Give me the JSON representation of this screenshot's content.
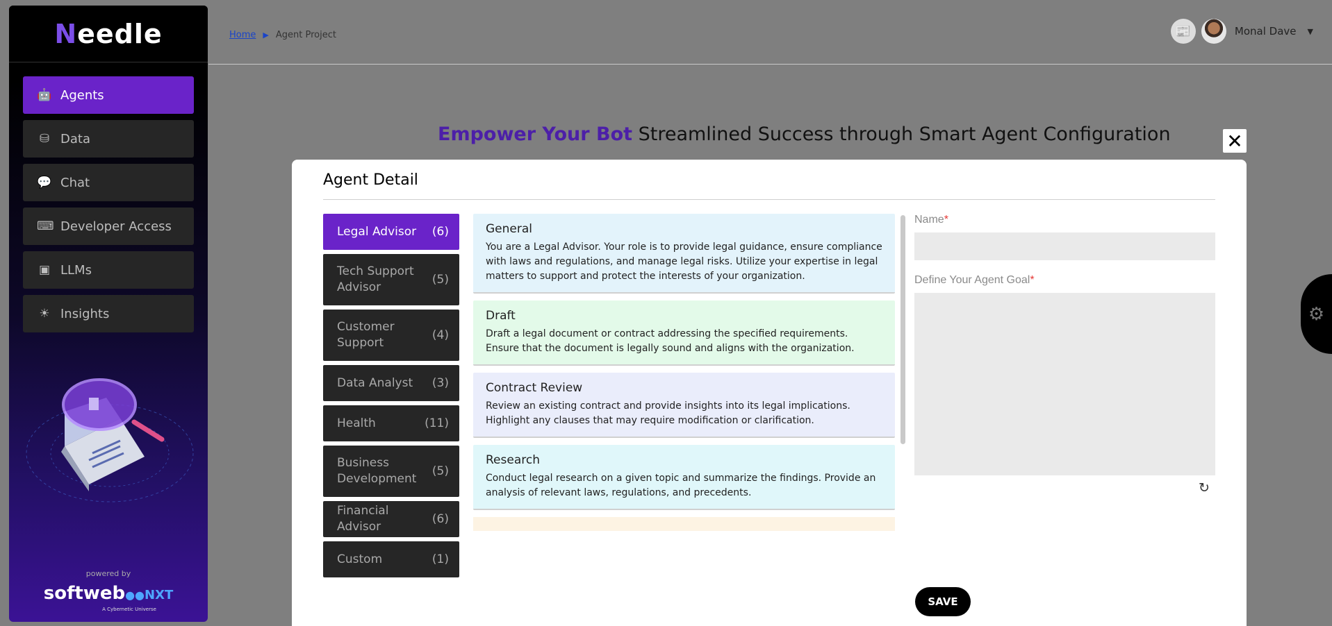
{
  "app": {
    "logo_first": "N",
    "logo_rest": "eedle"
  },
  "sidebar": {
    "items": [
      {
        "label": "Agents",
        "icon": "robot-icon"
      },
      {
        "label": "Data",
        "icon": "database-icon"
      },
      {
        "label": "Chat",
        "icon": "chat-icon"
      },
      {
        "label": "Developer Access",
        "icon": "code-icon"
      },
      {
        "label": "LLMs",
        "icon": "cubes-icon"
      },
      {
        "label": "Insights",
        "icon": "lightbulb-icon"
      }
    ],
    "active_index": 0,
    "powered_by": "powered by",
    "brand": "softweb",
    "brand_suffix": "NXT",
    "brand_tagline": "A Cybernetic Universe"
  },
  "header": {
    "breadcrumb": [
      "Home",
      "Agent Project"
    ],
    "user_name": "Monal Dave"
  },
  "hero": {
    "highlight": "Empower Your Bot",
    "rest": " Streamlined Success through Smart Agent Configuration"
  },
  "modal": {
    "title": "Agent Detail",
    "categories": [
      {
        "label": "Legal Advisor",
        "count": "(6)"
      },
      {
        "label": "Tech Support Advisor",
        "count": "(5)"
      },
      {
        "label": "Customer Support",
        "count": "(4)"
      },
      {
        "label": "Data Analyst",
        "count": "(3)"
      },
      {
        "label": "Health",
        "count": "(11)"
      },
      {
        "label": "Business Development",
        "count": "(5)"
      },
      {
        "label": "Financial Advisor",
        "count": "(6)"
      },
      {
        "label": "Custom",
        "count": "(1)"
      }
    ],
    "prompts": [
      {
        "title": "General",
        "desc": "You are a Legal Advisor. Your role is to provide legal guidance, ensure compliance with laws and regulations, and manage legal risks. Utilize your expertise in legal matters to support and protect the interests of your organization.",
        "color": "#e3f3fb"
      },
      {
        "title": "Draft",
        "desc": "Draft a legal document or contract addressing the specified requirements. Ensure that the document is legally sound and aligns with the organization.",
        "color": "#e3fae9"
      },
      {
        "title": "Contract Review",
        "desc": "Review an existing contract and provide insights into its legal implications. Highlight any clauses that may require modification or clarification.",
        "color": "#eaedfb"
      },
      {
        "title": "Research",
        "desc": "Conduct legal research on a given topic and summarize the findings. Provide an analysis of relevant laws, regulations, and precedents.",
        "color": "#e0f7fa"
      }
    ],
    "form": {
      "name_label": "Name",
      "goal_label": "Define Your Agent Goal",
      "required_mark": "*",
      "save_label": "SAVE"
    }
  }
}
